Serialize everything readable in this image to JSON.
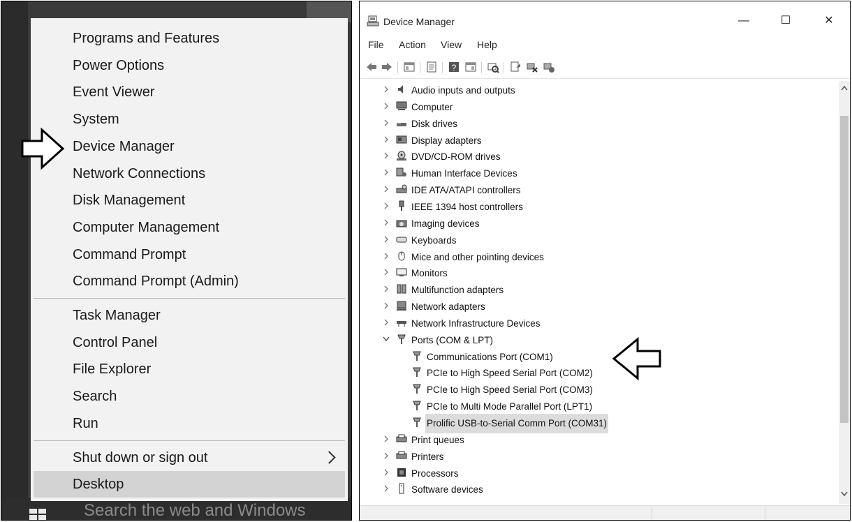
{
  "winx_menu": {
    "group1": [
      "Programs and Features",
      "Power Options",
      "Event Viewer",
      "System",
      "Device Manager",
      "Network Connections",
      "Disk Management",
      "Computer Management",
      "Command Prompt",
      "Command Prompt (Admin)"
    ],
    "group2": [
      "Task Manager",
      "Control Panel",
      "File Explorer",
      "Search",
      "Run"
    ],
    "shutdown": "Shut down or sign out",
    "desktop": "Desktop"
  },
  "taskbar": {
    "search_placeholder": "Search the web and Windows"
  },
  "device_manager": {
    "title": "Device Manager",
    "window_controls": {
      "minimize": "—",
      "maximize": "☐",
      "close": "✕"
    },
    "menu": [
      "File",
      "Action",
      "View",
      "Help"
    ],
    "tree": [
      {
        "label": "Audio inputs and outputs",
        "icon": "speaker-icon"
      },
      {
        "label": "Computer",
        "icon": "computer-icon"
      },
      {
        "label": "Disk drives",
        "icon": "disk-drive-icon"
      },
      {
        "label": "Display adapters",
        "icon": "display-adapter-icon"
      },
      {
        "label": "DVD/CD-ROM drives",
        "icon": "dvd-drive-icon"
      },
      {
        "label": "Human Interface Devices",
        "icon": "hid-icon"
      },
      {
        "label": "IDE ATA/ATAPI controllers",
        "icon": "ide-controller-icon"
      },
      {
        "label": "IEEE 1394 host controllers",
        "icon": "ieee1394-icon"
      },
      {
        "label": "Imaging devices",
        "icon": "camera-icon"
      },
      {
        "label": "Keyboards",
        "icon": "keyboard-icon"
      },
      {
        "label": "Mice and other pointing devices",
        "icon": "mouse-icon"
      },
      {
        "label": "Monitors",
        "icon": "monitor-icon"
      },
      {
        "label": "Multifunction adapters",
        "icon": "multifunction-icon"
      },
      {
        "label": "Network adapters",
        "icon": "network-adapter-icon"
      },
      {
        "label": "Network Infrastructure Devices",
        "icon": "network-infra-icon"
      },
      {
        "label": "Ports (COM & LPT)",
        "icon": "port-icon",
        "expanded": true
      },
      {
        "label": "Communications Port (COM1)",
        "icon": "port-icon",
        "child": true
      },
      {
        "label": "PCIe to High Speed Serial Port (COM2)",
        "icon": "port-icon",
        "child": true
      },
      {
        "label": "PCIe to High Speed Serial Port (COM3)",
        "icon": "port-icon",
        "child": true
      },
      {
        "label": "PCIe to Multi Mode Parallel Port (LPT1)",
        "icon": "port-icon",
        "child": true
      },
      {
        "label": "Prolific USB-to-Serial Comm Port (COM31)",
        "icon": "port-icon",
        "child": true,
        "selected": true
      },
      {
        "label": "Print queues",
        "icon": "printer-icon"
      },
      {
        "label": "Printers",
        "icon": "printer-icon"
      },
      {
        "label": "Processors",
        "icon": "processor-icon"
      },
      {
        "label": "Software devices",
        "icon": "software-device-icon"
      }
    ]
  }
}
